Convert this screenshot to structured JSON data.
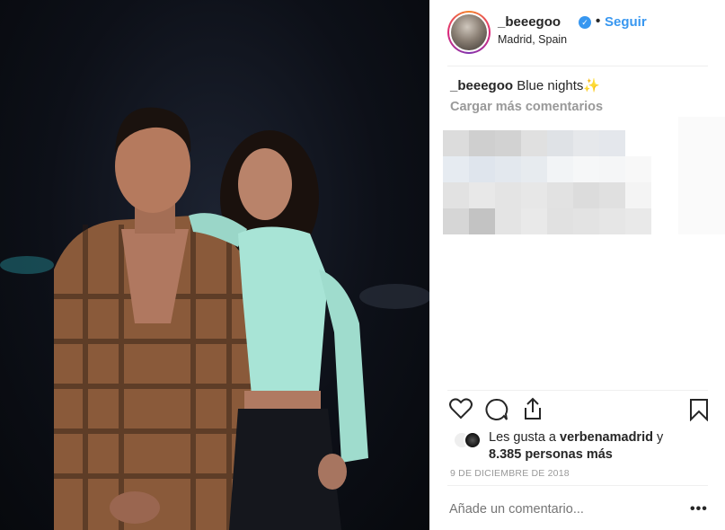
{
  "post": {
    "username": "_beeegoo",
    "verified_glyph": "✓",
    "separator": "•",
    "follow_label": "Seguir",
    "location": "Madrid, Spain",
    "caption_user": "_beeegoo",
    "caption_text": " Blue nights✨",
    "load_more_label": "Cargar más comentarios",
    "likes_prefix": "Les gusta a ",
    "likes_user": "verbenamadrid",
    "likes_conj": " y",
    "likes_others": "8.385 personas más",
    "date": "9 DE DICIEMBRE DE 2018",
    "comment_placeholder": "Añade un comentario...",
    "more_label": "•••"
  },
  "icons": {
    "like": "heart-icon",
    "comment": "comment-icon",
    "share": "share-icon",
    "save": "bookmark-icon"
  },
  "colors": {
    "accent": "#3897f0",
    "text": "#262626",
    "muted": "#999999"
  }
}
